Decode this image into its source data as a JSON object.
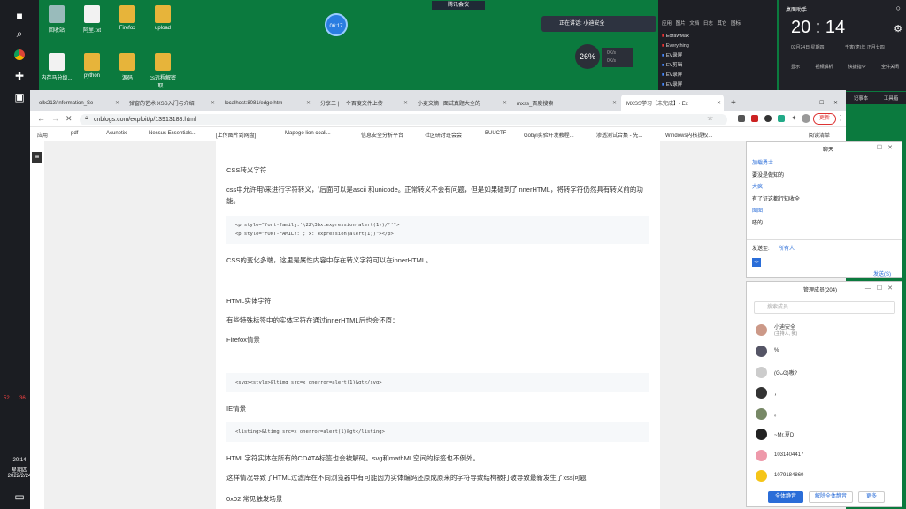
{
  "desktop": {
    "icons": [
      {
        "label": "回收站",
        "type": "recycle"
      },
      {
        "label": "阿里.txt",
        "type": "file"
      },
      {
        "label": "Firefox",
        "type": "folder"
      },
      {
        "label": "upload",
        "type": "folder"
      },
      {
        "label": "内存马分级...",
        "type": "file"
      },
      {
        "label": "python",
        "type": "folder"
      },
      {
        "label": "源码",
        "type": "folder"
      },
      {
        "label": "cs远程解密取...",
        "type": "folder"
      }
    ],
    "meeting_label": "腾讯会议",
    "timer_badge": "06:17",
    "speaking_label": "正在讲话: 小迪安全",
    "net_percent": "26%",
    "net_up": "0K/s",
    "net_down": "0K/s"
  },
  "taskbar": {
    "num_52": "52",
    "num_36": "36",
    "clock_time": "20:14",
    "clock_day": "星期四",
    "clock_date": "2022/2/24"
  },
  "qq_menu": {
    "tabs": [
      "应用",
      "图片",
      "文档",
      "日志",
      "其它",
      "图标"
    ],
    "items": [
      "EdrawMax",
      "Everything",
      "EV录屏",
      "EV剪辑",
      "EV录屏",
      "EV录屏"
    ]
  },
  "clock_widget": {
    "title": "桌面助手",
    "time": "20 : 14",
    "date": "02月24日 星期四",
    "lunar": "壬寅(虎)年 正月廿四",
    "tools": [
      "截图",
      "录像",
      "翻译",
      "查看器"
    ],
    "tools2": [
      "显示",
      "视频解析",
      "快捷指令",
      "全件关闭"
    ],
    "tools3": [
      "记事本",
      "工具箱"
    ]
  },
  "browser": {
    "tabs": [
      {
        "label": "ollx213/Information_Se"
      },
      {
        "label": "弹窗的艺术 XSS入门与介绍"
      },
      {
        "label": "localhost:8081/edge.htm"
      },
      {
        "label": "分享二 | 一个百度文件上传"
      },
      {
        "label": "小麦文摘 | 面试真题大全的"
      },
      {
        "label": "mxss_百度搜索"
      },
      {
        "label": "MXSS学习【未完成】- Ex"
      }
    ],
    "url": "cnblogs.com/exploit/p/13913188.html",
    "update_label": "更新",
    "bookmarks": [
      "应用",
      "pdf",
      "Acunetix",
      "Nessus Essentials...",
      "[上传图片到网盘]",
      "Mapogo lion coali...",
      "信息安全分析平台",
      "社区研讨班会会",
      "BUUCTF",
      "Gobyi实验开发教程...",
      "渗透测试合集 - 先...",
      "Windows内核提权..."
    ],
    "reading_list": "阅读清单"
  },
  "article": {
    "h_css": "CSS转义字符",
    "p_css": "css中允许用\\来进行字符转义，\\后面可以是ascii 和unicode。正常转义不会有问题，但是如果碰到了innerHTML，将转字符仍然具有转义前的功能。",
    "code_css_1": "<p style=\"font-family:'\\22\\3bx:expression(alert(1))/*'\">",
    "code_css_2": "<p style=\"FONT-FAMILY: ; x: expression(alert(1))\"></p>",
    "p_css2": "CSS的变化多端，这里是属性内容中存在转义字符可以在innerHTML。",
    "h_html": "HTML实体字符",
    "p_html": "有些特殊标签中的实体字符在通过innerHTML后也会还原：",
    "ff_label": "Firefox情景",
    "code_ff": "<svg><style>&ltimg src=x onerror=alert(1)&gt</svg>",
    "ie_label": "IE情景",
    "code_ie": "<listing>&ltimg src=x onerror=alert(1)&gt</listing>",
    "p_cdata": "HTML字符实体在所有的CDATA标签也会被解码。svg和mathML空间的标签也不例外。",
    "p_filter": "这样情况导致了HTML过滤库在不同浏览器中有可能因为实体编码还原成原来的字符导致结构被打破导致最新发生了xss问题",
    "h_0x02": "0x02 常见触发场景"
  },
  "chat": {
    "title": "聊天",
    "messages": [
      {
        "who": "加载勇士",
        "text": "要没是做知的"
      },
      {
        "who": "大疯",
        "text": "有了证这都行知收全"
      },
      {
        "who": "图图",
        "text": "嗒的"
      }
    ],
    "send_to_label": "发送至:",
    "send_to_value": "所有人",
    "send_button": "发送(S)"
  },
  "members": {
    "title": "管理成员(204)",
    "search_placeholder": "搜索成员",
    "list": [
      {
        "name": "小迪安全",
        "sub": "(主持人, 我)"
      },
      {
        "name": "%",
        "sub": ""
      },
      {
        "name": "(ʘᴗʘ)嗷?",
        "sub": ""
      },
      {
        "name": "，",
        "sub": ""
      },
      {
        "name": "。",
        "sub": ""
      },
      {
        "name": "~Mr.夏D",
        "sub": ""
      },
      {
        "name": "1031404417",
        "sub": ""
      },
      {
        "name": "1079184860",
        "sub": ""
      }
    ],
    "btn_mute_all": "全体静音",
    "btn_unmute_all": "解除全体静音",
    "btn_more": "更多"
  }
}
